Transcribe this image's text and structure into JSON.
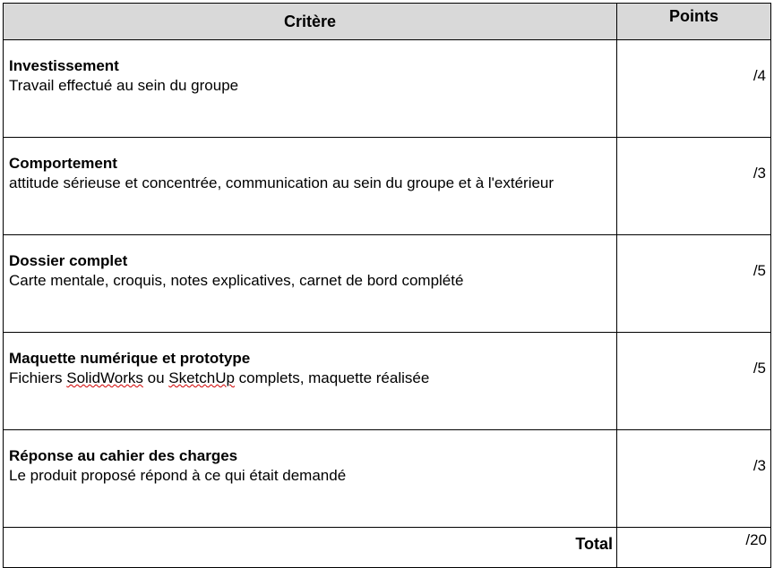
{
  "header": {
    "criterion": "Critère",
    "points": "Points"
  },
  "rows": [
    {
      "title": "Investissement",
      "desc": "Travail effectué au sein du groupe",
      "points": "/4"
    },
    {
      "title": "Comportement",
      "desc": "attitude sérieuse et concentrée, communication au sein du groupe et à l'extérieur",
      "points": "/3"
    },
    {
      "title": "Dossier complet",
      "desc": "Carte mentale, croquis, notes explicatives, carnet de bord complété",
      "points": "/5"
    },
    {
      "title": "Maquette numérique et prototype",
      "desc_parts": [
        "Fichiers ",
        "SolidWorks",
        " ou ",
        "SketchUp",
        " complets, maquette réalisée"
      ],
      "points": "/5"
    },
    {
      "title": "Réponse au cahier des charges",
      "desc": "Le produit proposé répond à ce qui était demandé",
      "points": "/3"
    }
  ],
  "total": {
    "label": "Total",
    "points": "/20"
  }
}
